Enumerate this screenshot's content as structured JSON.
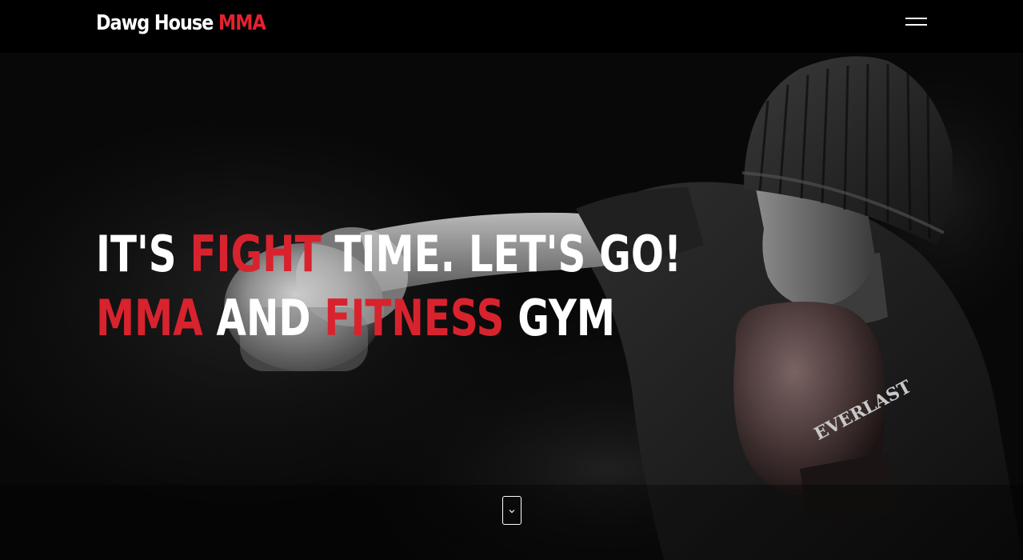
{
  "navbar": {
    "brand_primary": "Dawg House",
    "brand_accent": "MMA",
    "menu_icon": "hamburger-menu-icon"
  },
  "hero": {
    "line1": {
      "part1": "IT'S ",
      "part2": "FIGHT",
      "part3": " TIME. LET'S GO!"
    },
    "line2": {
      "part1": "MMA",
      "part2": " AND ",
      "part3": "FITNESS",
      "part4": " GYM"
    },
    "background_image": "boxer-punching-photo",
    "glove_brand_text": "EVERLAST",
    "scroll_icon": "chevron-down-icon"
  },
  "colors": {
    "accent": "#d8232f",
    "navbar_bg": "#000000",
    "text": "#ffffff"
  }
}
